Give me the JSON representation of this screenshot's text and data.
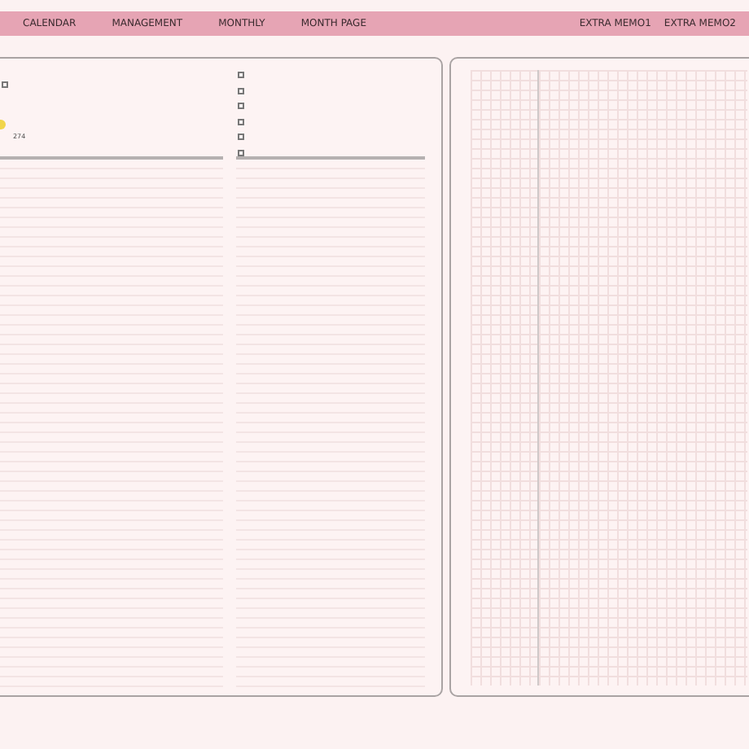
{
  "nav_left": [
    "CALENDAR",
    "MANAGEMENT",
    "MONTHLY",
    "MONTH PAGE"
  ],
  "nav_right": [
    "EXTRA MEMO1",
    "EXTRA MEMO2"
  ],
  "left_page": {
    "checkbox": {
      "checked": false
    },
    "number": "274"
  },
  "todo_checkboxes": [
    {
      "checked": false
    },
    {
      "checked": false
    },
    {
      "checked": false
    },
    {
      "checked": false
    },
    {
      "checked": false
    },
    {
      "checked": false
    }
  ]
}
